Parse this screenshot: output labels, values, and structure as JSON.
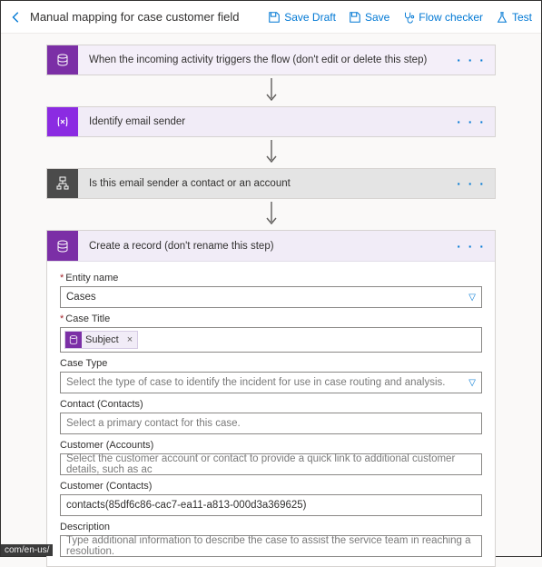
{
  "header": {
    "title": "Manual mapping for case customer field",
    "buttons": {
      "save_draft": "Save Draft",
      "save": "Save",
      "flow_checker": "Flow checker",
      "test": "Test"
    }
  },
  "steps": {
    "trigger": {
      "label": "When the incoming activity triggers the flow (don't edit or delete this step)",
      "menu": "· · ·"
    },
    "identify": {
      "label": "Identify email sender",
      "menu": "· · ·"
    },
    "condition": {
      "label": "Is this email sender a contact or an account",
      "menu": "· · ·"
    },
    "create": {
      "label": "Create a record (don't rename this step)",
      "menu": "· · ·"
    }
  },
  "form": {
    "entity_name": {
      "label": "Entity name",
      "value": "Cases"
    },
    "case_title": {
      "label": "Case Title",
      "token": "Subject"
    },
    "case_type": {
      "label": "Case Type",
      "placeholder": "Select the type of case to identify the incident for use in case routing and analysis."
    },
    "contact_contacts": {
      "label": "Contact (Contacts)",
      "placeholder": "Select a primary contact for this case."
    },
    "customer_accounts": {
      "label": "Customer (Accounts)",
      "placeholder": "Select the customer account or contact to provide a quick link to additional customer details, such as ac"
    },
    "customer_contacts": {
      "label": "Customer (Contacts)",
      "value": "contacts(85df6c86-cac7-ea11-a813-000d3a369625)"
    },
    "description": {
      "label": "Description",
      "placeholder": "Type additional information to describe the case to assist the service team in reaching a resolution."
    }
  },
  "status_url": "com/en-us/"
}
